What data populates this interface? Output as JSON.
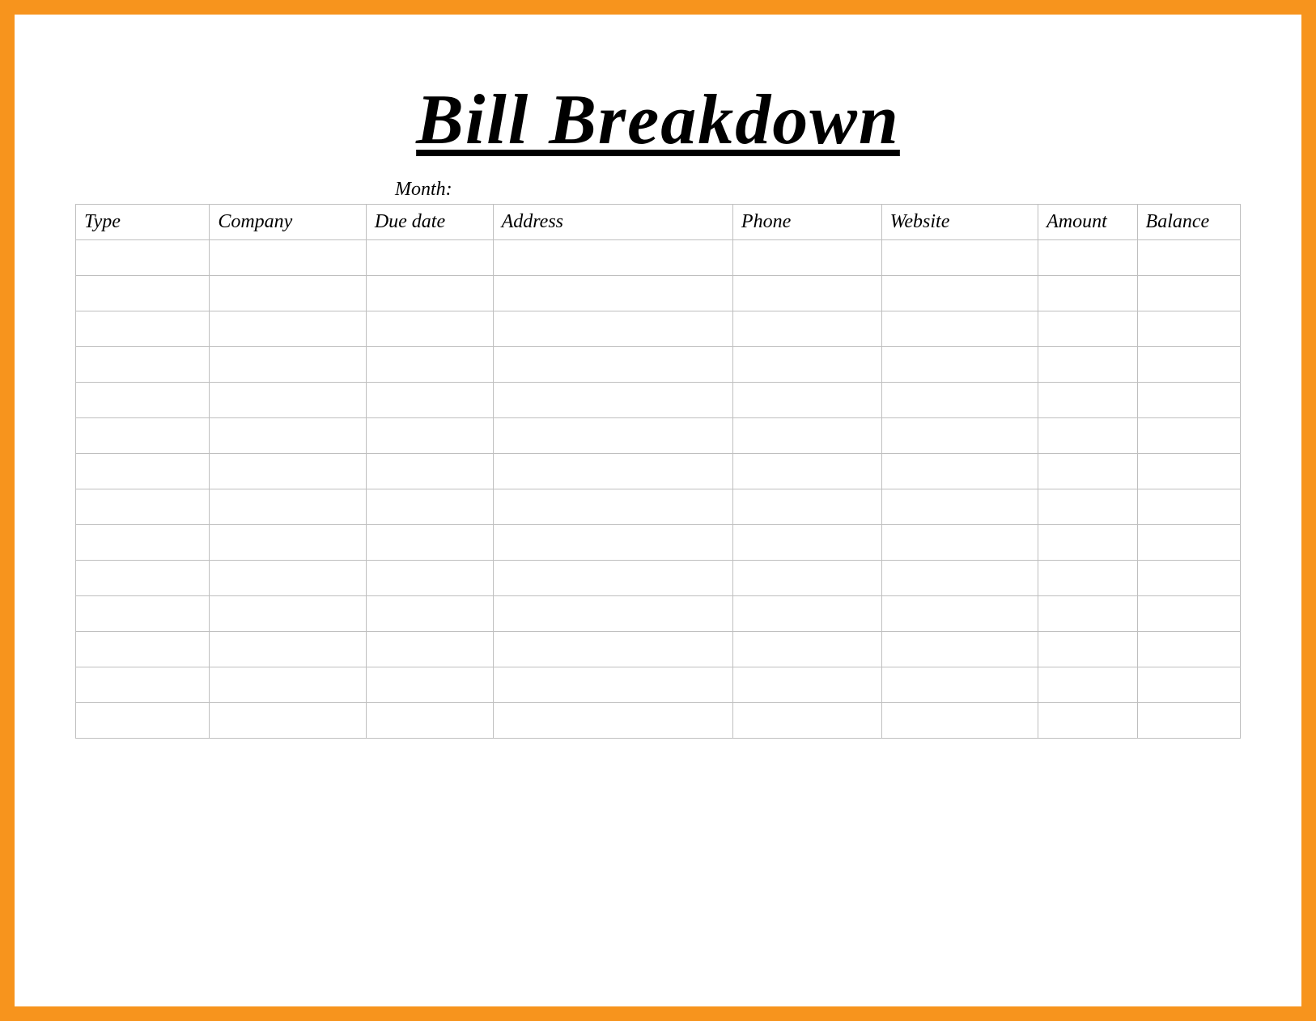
{
  "title": "Bill Breakdown",
  "month_label": "Month:",
  "headers": {
    "type": "Type",
    "company": "Company",
    "due_date": "Due date",
    "address": "Address",
    "phone": "Phone",
    "website": "Website",
    "amount": "Amount",
    "balance": "Balance"
  },
  "rows": [
    {
      "type": "",
      "company": "",
      "due_date": "",
      "address": "",
      "phone": "",
      "website": "",
      "amount": "",
      "balance": ""
    },
    {
      "type": "",
      "company": "",
      "due_date": "",
      "address": "",
      "phone": "",
      "website": "",
      "amount": "",
      "balance": ""
    },
    {
      "type": "",
      "company": "",
      "due_date": "",
      "address": "",
      "phone": "",
      "website": "",
      "amount": "",
      "balance": ""
    },
    {
      "type": "",
      "company": "",
      "due_date": "",
      "address": "",
      "phone": "",
      "website": "",
      "amount": "",
      "balance": ""
    },
    {
      "type": "",
      "company": "",
      "due_date": "",
      "address": "",
      "phone": "",
      "website": "",
      "amount": "",
      "balance": ""
    },
    {
      "type": "",
      "company": "",
      "due_date": "",
      "address": "",
      "phone": "",
      "website": "",
      "amount": "",
      "balance": ""
    },
    {
      "type": "",
      "company": "",
      "due_date": "",
      "address": "",
      "phone": "",
      "website": "",
      "amount": "",
      "balance": ""
    },
    {
      "type": "",
      "company": "",
      "due_date": "",
      "address": "",
      "phone": "",
      "website": "",
      "amount": "",
      "balance": ""
    },
    {
      "type": "",
      "company": "",
      "due_date": "",
      "address": "",
      "phone": "",
      "website": "",
      "amount": "",
      "balance": ""
    },
    {
      "type": "",
      "company": "",
      "due_date": "",
      "address": "",
      "phone": "",
      "website": "",
      "amount": "",
      "balance": ""
    },
    {
      "type": "",
      "company": "",
      "due_date": "",
      "address": "",
      "phone": "",
      "website": "",
      "amount": "",
      "balance": ""
    },
    {
      "type": "",
      "company": "",
      "due_date": "",
      "address": "",
      "phone": "",
      "website": "",
      "amount": "",
      "balance": ""
    },
    {
      "type": "",
      "company": "",
      "due_date": "",
      "address": "",
      "phone": "",
      "website": "",
      "amount": "",
      "balance": ""
    },
    {
      "type": "",
      "company": "",
      "due_date": "",
      "address": "",
      "phone": "",
      "website": "",
      "amount": "",
      "balance": ""
    }
  ]
}
